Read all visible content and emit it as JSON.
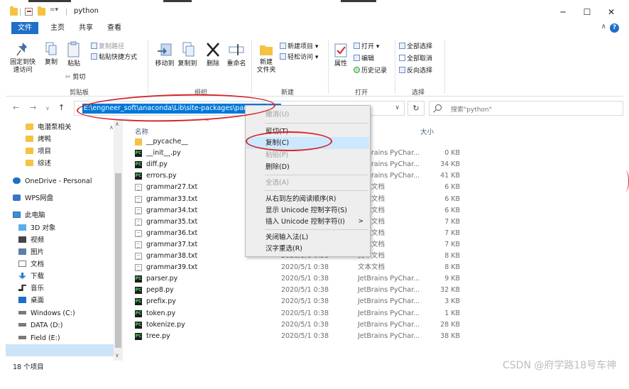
{
  "window": {
    "title": "python",
    "minimize": "─",
    "maximize": "☐",
    "close": "✕"
  },
  "menu": {
    "tabs": [
      "文件",
      "主页",
      "共享",
      "查看"
    ],
    "collapse": "∧",
    "help": "?"
  },
  "ribbon": {
    "clipboard": {
      "pin": "固定到快\n速访问",
      "copy": "复制",
      "paste": "粘贴",
      "copy_path": "复制路径",
      "paste_shortcut": "粘贴快捷方式",
      "cut": "剪切",
      "label": "剪贴板"
    },
    "organize": {
      "move_to": "移动到",
      "copy_to": "复制到",
      "delete": "删除",
      "rename": "重命名",
      "label": "组织"
    },
    "new": {
      "new_folder": "新建\n文件夹",
      "new_item": "新建项目 ▾",
      "easy_access": "轻松访问 ▾",
      "label": "新建"
    },
    "open": {
      "properties": "属性",
      "open": "打开 ▾",
      "edit": "编辑",
      "history": "历史记录",
      "label": "打开"
    },
    "select": {
      "select_all": "全部选择",
      "select_none": "全部取消",
      "invert": "反向选择",
      "label": "选择"
    }
  },
  "address": {
    "path": "E:\\engneer_soft\\anaconda\\Lib\\site-packages\\parso\\python",
    "search_placeholder": "搜索\"python\"",
    "back": "←",
    "forward": "→",
    "up": "↑",
    "chevron": "∨",
    "refresh": "↻"
  },
  "sidebar": {
    "items": [
      "电潜泵相关",
      "烤鸭",
      "项目",
      "综述",
      "OneDrive - Personal",
      "WPS网盘",
      "此电脑",
      "3D 对象",
      "视频",
      "图片",
      "文档",
      "下载",
      "音乐",
      "桌面",
      "Windows (C:)",
      "DATA (D:)",
      "Field (E:)"
    ]
  },
  "columns": {
    "name": "名称",
    "size": "大小",
    "sort_indicator": "^"
  },
  "files": [
    {
      "name": "__pycache__",
      "date": "",
      "type": "",
      "size": "",
      "icon": "folder"
    },
    {
      "name": "__init__.py",
      "date": "",
      "type": "JetBrains PyChar...",
      "size": "0 KB",
      "icon": "py"
    },
    {
      "name": "diff.py",
      "date": "",
      "type": "JetBrains PyChar...",
      "size": "34 KB",
      "icon": "py"
    },
    {
      "name": "errors.py",
      "date": "",
      "type": "JetBrains PyChar...",
      "size": "41 KB",
      "icon": "py"
    },
    {
      "name": "grammar27.txt",
      "date": "",
      "type": "文本文档",
      "size": "6 KB",
      "icon": "txt"
    },
    {
      "name": "grammar33.txt",
      "date": "",
      "type": "文本文档",
      "size": "6 KB",
      "icon": "txt"
    },
    {
      "name": "grammar34.txt",
      "date": "",
      "type": "文本文档",
      "size": "6 KB",
      "icon": "txt"
    },
    {
      "name": "grammar35.txt",
      "date": "",
      "type": "文本文档",
      "size": "7 KB",
      "icon": "txt"
    },
    {
      "name": "grammar36.txt",
      "date": "",
      "type": "文本文档",
      "size": "7 KB",
      "icon": "txt"
    },
    {
      "name": "grammar37.txt",
      "date": "",
      "type": "文本文档",
      "size": "7 KB",
      "icon": "txt"
    },
    {
      "name": "grammar38.txt",
      "date": "2020/5/1 0:38",
      "type": "文本文档",
      "size": "8 KB",
      "icon": "txt"
    },
    {
      "name": "grammar39.txt",
      "date": "2020/5/1 0:38",
      "type": "文本文档",
      "size": "8 KB",
      "icon": "txt"
    },
    {
      "name": "parser.py",
      "date": "2020/5/1 0:38",
      "type": "JetBrains PyChar...",
      "size": "9 KB",
      "icon": "py"
    },
    {
      "name": "pep8.py",
      "date": "2020/5/1 0:38",
      "type": "JetBrains PyChar...",
      "size": "32 KB",
      "icon": "py"
    },
    {
      "name": "prefix.py",
      "date": "2020/5/1 0:38",
      "type": "JetBrains PyChar...",
      "size": "3 KB",
      "icon": "py"
    },
    {
      "name": "token.py",
      "date": "2020/5/1 0:38",
      "type": "JetBrains PyChar...",
      "size": "1 KB",
      "icon": "py"
    },
    {
      "name": "tokenize.py",
      "date": "2020/5/1 0:38",
      "type": "JetBrains PyChar...",
      "size": "28 KB",
      "icon": "py"
    },
    {
      "name": "tree.py",
      "date": "2020/5/1 0:38",
      "type": "JetBrains PyChar...",
      "size": "38 KB",
      "icon": "py"
    }
  ],
  "status": {
    "count": "18 个项目"
  },
  "context_menu": {
    "undo": "撤消(U)",
    "cut": "剪切(T)",
    "copy": "复制(C)",
    "paste": "粘贴(P)",
    "delete": "删除(D)",
    "select_all": "全选(A)",
    "rtl": "从右到左的阅读顺序(R)",
    "show_unicode": "显示 Unicode 控制字符(S)",
    "insert_unicode": "插入 Unicode 控制字符(I)",
    "submenu_arrow": ">",
    "close_ime": "关闭输入法(L)",
    "reconvert": "汉字重选(R)"
  },
  "watermark": "CSDN @府学路18号车神",
  "colors": {
    "accent": "#1e6fc8",
    "selection": "#0078d7",
    "annotation": "#d5262c"
  }
}
